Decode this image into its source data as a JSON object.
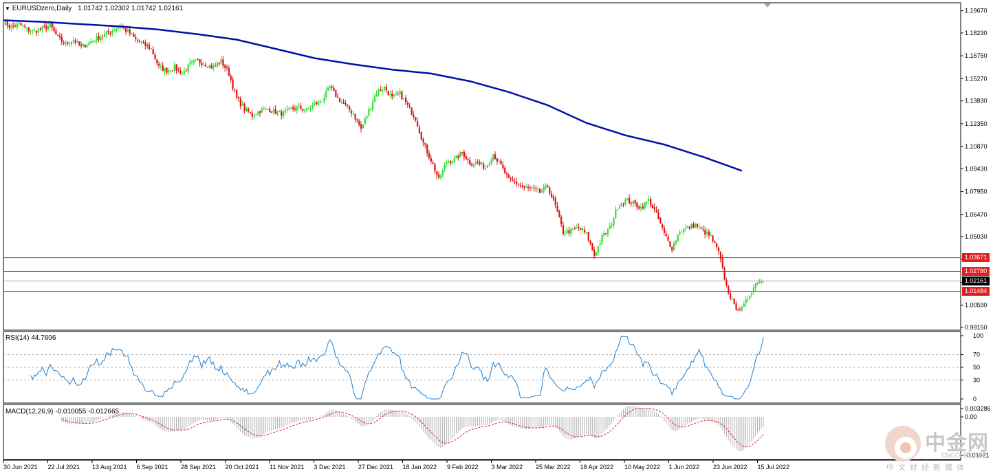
{
  "header": {
    "symbol_label": "EURUSDzero,Daily",
    "ohlc_label": "1.01742 1.02302 1.01742 1.02161"
  },
  "rsi_label": "RSI(14) 44.7606",
  "macd_label": "MACD(12,26,9) -0.010055 -0.012665",
  "colors": {
    "bull": "#33dd33",
    "bear": "#dd1111",
    "ma": "#0010a8",
    "hline": "#e02020",
    "rsi": "#1e7fd0",
    "macd_hist": "#b0b0b0",
    "macd_signal": "#e02020"
  },
  "watermark": {
    "cn": "中金网",
    "en": "CNGOLD.COM",
    "sub": "中文财经新媒体"
  },
  "chart_data": [
    {
      "type": "candlestick",
      "name": "EURUSDzero",
      "timeframe": "Daily",
      "ylim": [
        0.9915,
        1.1992
      ],
      "y_ticks": [
        "1.19670",
        "1.18230",
        "1.16750",
        "1.15270",
        "1.13830",
        "1.12350",
        "1.10870",
        "1.09430",
        "1.07950",
        "1.06470",
        "1.05030",
        "1.03550",
        "1.02070",
        "1.00590",
        "0.99150"
      ],
      "x_tick_labels": [
        "30 Jun 2021",
        "22 Jul 2021",
        "13 Aug 2021",
        "6 Sep 2021",
        "28 Sep 2021",
        "20 Oct 2021",
        "11 Nov 2021",
        "3 Dec 2021",
        "27 Dec 2021",
        "18 Jan 2022",
        "9 Feb 2022",
        "3 Mar 2022",
        "25 Mar 2022",
        "18 Apr 2022",
        "10 May 2022",
        "1 Jun 2022",
        "23 Jun 2022",
        "15 Jul 2022"
      ],
      "close_path": [
        [
          0,
          1.1895
        ],
        [
          4,
          1.186
        ],
        [
          8,
          1.188
        ],
        [
          12,
          1.1845
        ],
        [
          16,
          1.1835
        ],
        [
          20,
          1.185
        ],
        [
          24,
          1.187
        ],
        [
          28,
          1.179
        ],
        [
          32,
          1.175
        ],
        [
          36,
          1.178
        ],
        [
          40,
          1.173
        ],
        [
          44,
          1.176
        ],
        [
          48,
          1.179
        ],
        [
          52,
          1.181
        ],
        [
          56,
          1.184
        ],
        [
          60,
          1.187
        ],
        [
          64,
          1.183
        ],
        [
          68,
          1.178
        ],
        [
          72,
          1.175
        ],
        [
          76,
          1.172
        ],
        [
          80,
          1.16
        ],
        [
          84,
          1.158
        ],
        [
          88,
          1.16
        ],
        [
          92,
          1.156
        ],
        [
          96,
          1.162
        ],
        [
          100,
          1.164
        ],
        [
          104,
          1.162
        ],
        [
          108,
          1.16
        ],
        [
          112,
          1.164
        ],
        [
          116,
          1.156
        ],
        [
          120,
          1.14
        ],
        [
          124,
          1.133
        ],
        [
          128,
          1.129
        ],
        [
          132,
          1.132
        ],
        [
          136,
          1.133
        ],
        [
          140,
          1.131
        ],
        [
          144,
          1.13
        ],
        [
          148,
          1.133
        ],
        [
          152,
          1.134
        ],
        [
          156,
          1.132
        ],
        [
          160,
          1.136
        ],
        [
          164,
          1.139
        ],
        [
          168,
          1.147
        ],
        [
          172,
          1.14
        ],
        [
          176,
          1.135
        ],
        [
          180,
          1.13
        ],
        [
          184,
          1.12
        ],
        [
          188,
          1.132
        ],
        [
          192,
          1.144
        ],
        [
          196,
          1.147
        ],
        [
          200,
          1.14
        ],
        [
          204,
          1.143
        ],
        [
          208,
          1.135
        ],
        [
          212,
          1.127
        ],
        [
          216,
          1.111
        ],
        [
          220,
          1.1
        ],
        [
          224,
          1.087
        ],
        [
          228,
          1.099
        ],
        [
          232,
          1.1
        ],
        [
          236,
          1.105
        ],
        [
          240,
          1.098
        ],
        [
          244,
          1.098
        ],
        [
          248,
          1.095
        ],
        [
          252,
          1.104
        ],
        [
          256,
          1.096
        ],
        [
          260,
          1.087
        ],
        [
          264,
          1.085
        ],
        [
          268,
          1.082
        ],
        [
          272,
          1.081
        ],
        [
          276,
          1.079
        ],
        [
          280,
          1.083
        ],
        [
          284,
          1.07
        ],
        [
          288,
          1.053
        ],
        [
          292,
          1.054
        ],
        [
          296,
          1.056
        ],
        [
          300,
          1.052
        ],
        [
          304,
          1.038
        ],
        [
          308,
          1.05
        ],
        [
          312,
          1.056
        ],
        [
          316,
          1.07
        ],
        [
          320,
          1.074
        ],
        [
          324,
          1.072
        ],
        [
          328,
          1.069
        ],
        [
          332,
          1.074
        ],
        [
          336,
          1.065
        ],
        [
          340,
          1.052
        ],
        [
          344,
          1.043
        ],
        [
          348,
          1.054
        ],
        [
          352,
          1.056
        ],
        [
          356,
          1.058
        ],
        [
          360,
          1.054
        ],
        [
          364,
          1.05
        ],
        [
          368,
          1.04
        ],
        [
          372,
          1.018
        ],
        [
          376,
          1.005
        ],
        [
          380,
          1.003
        ],
        [
          384,
          1.013
        ],
        [
          388,
          1.022
        ],
        [
          391,
          1.0216
        ]
      ],
      "moving_average": {
        "color": "#0010a8",
        "points": [
          [
            0,
            1.1905
          ],
          [
            20,
            1.1895
          ],
          [
            40,
            1.188
          ],
          [
            60,
            1.1865
          ],
          [
            80,
            1.1845
          ],
          [
            100,
            1.1815
          ],
          [
            120,
            1.178
          ],
          [
            140,
            1.172
          ],
          [
            160,
            1.166
          ],
          [
            180,
            1.162
          ],
          [
            200,
            1.1585
          ],
          [
            220,
            1.156
          ],
          [
            240,
            1.151
          ],
          [
            260,
            1.144
          ],
          [
            280,
            1.1355
          ],
          [
            300,
            1.124
          ],
          [
            320,
            1.116
          ],
          [
            340,
            1.11
          ],
          [
            360,
            1.102
          ],
          [
            380,
            1.093
          ]
        ]
      },
      "horizontal_lines": [
        {
          "price": 1.03671,
          "label": "1.03671"
        },
        {
          "price": 1.0278,
          "label": "1.02780"
        },
        {
          "price": 1.01484,
          "label": "1.01484"
        }
      ],
      "current_price": {
        "price": 1.02161,
        "label": "1.02161"
      }
    },
    {
      "type": "line",
      "name": "RSI(14)",
      "ylim": [
        0,
        100
      ],
      "y_ticks": [
        "100",
        "70",
        "50",
        "30",
        "0"
      ],
      "levels": [
        70,
        50,
        30
      ],
      "last_value": 44.7606
    },
    {
      "type": "bar",
      "name": "MACD(12,26,9)",
      "ylim": [
        -0.01521,
        0.00328
      ],
      "y_ticks": [
        "0.003286",
        "0.00",
        "-0.01521"
      ],
      "macd": -0.010055,
      "signal": -0.012665
    }
  ]
}
